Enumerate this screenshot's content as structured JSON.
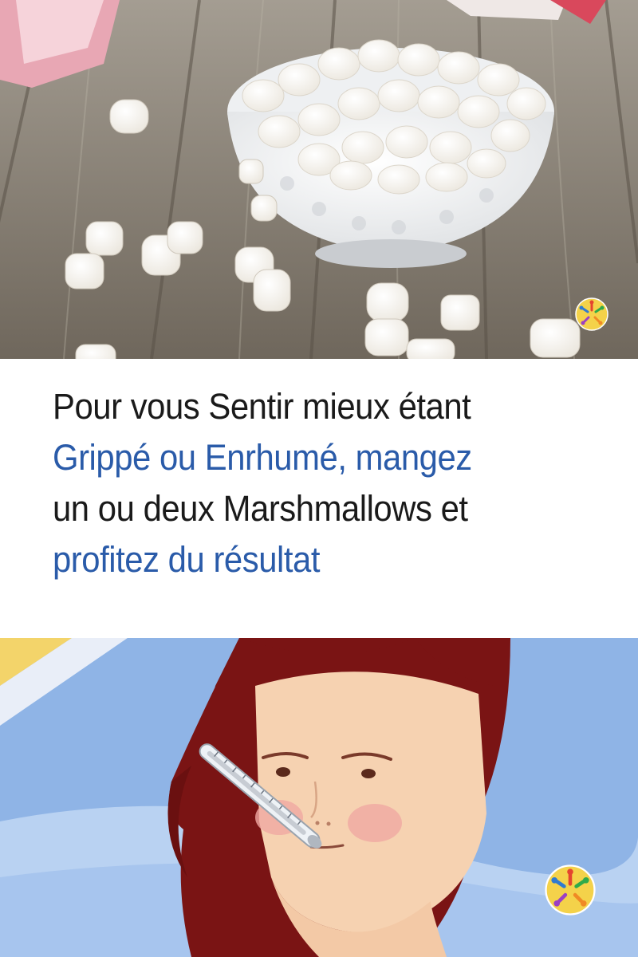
{
  "headline": {
    "lines": [
      "Pour vous Sentir mieux étant",
      "Grippé ou Enrhumé, mangez",
      "un ou deux Marshmallows et",
      "profitez du résultat"
    ]
  },
  "colors": {
    "headline_dark": "#1a1a1a",
    "headline_blue": "#2a5ba9",
    "wood": "#8a8276",
    "sky_blue": "#8fb4e6",
    "hair": "#7a1414",
    "skin": "#f6d2b1"
  },
  "icons": {
    "photo_badge": "people-circle-logo",
    "illustration_badge": "people-circle-logo"
  }
}
